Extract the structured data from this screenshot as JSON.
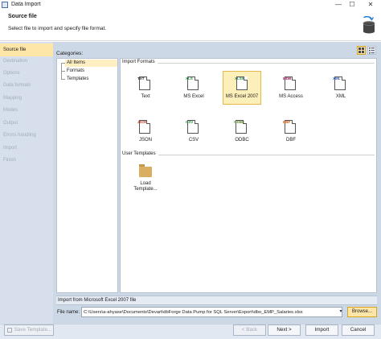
{
  "window": {
    "title": "Data Import",
    "minimize": "—",
    "maximize": "☐",
    "close": "✕"
  },
  "header": {
    "title": "Source file",
    "subtitle": "Select file to import and specify file format."
  },
  "sidebar": {
    "items": [
      {
        "label": "Source file",
        "active": true
      },
      {
        "label": "Destination",
        "active": false
      },
      {
        "label": "Options",
        "active": false
      },
      {
        "label": "Data formats",
        "active": false
      },
      {
        "label": "Mapping",
        "active": false
      },
      {
        "label": "Modes",
        "active": false
      },
      {
        "label": "Output",
        "active": false
      },
      {
        "label": "Errors handling",
        "active": false
      },
      {
        "label": "Import",
        "active": false
      },
      {
        "label": "Finish",
        "active": false
      }
    ]
  },
  "categories": {
    "label": "Categories:",
    "items": [
      "All Items",
      "Formats",
      "Templates"
    ]
  },
  "import_formats": {
    "title": "Import Formats",
    "tiles": [
      {
        "tag": "TXT",
        "caption": "Text",
        "color": "#222222",
        "icon": "text-file-icon"
      },
      {
        "tag": "XLS",
        "caption": "MS Excel",
        "color": "#1e8a3a",
        "icon": "excel-file-icon"
      },
      {
        "tag": "XLSX",
        "caption": "MS Excel 2007",
        "color": "#1e8a3a",
        "icon": "excel-2007-file-icon"
      },
      {
        "tag": "MDB",
        "caption": "MS Access",
        "color": "#a0205a",
        "icon": "access-file-icon"
      },
      {
        "tag": "XML",
        "caption": "XML",
        "color": "#2a55c0",
        "icon": "xml-file-icon"
      },
      {
        "tag": "JSON",
        "caption": "JSON",
        "color": "#c0392b",
        "icon": "json-file-icon"
      },
      {
        "tag": "CSV",
        "caption": "CSV",
        "color": "#1e8a3a",
        "icon": "csv-file-icon"
      },
      {
        "tag": "ODBC",
        "caption": "ODBC",
        "color": "#5a8a2a",
        "icon": "odbc-file-icon"
      },
      {
        "tag": "DBF",
        "caption": "DBF",
        "color": "#d35400",
        "icon": "dbf-file-icon"
      }
    ]
  },
  "user_templates": {
    "title": "User Templates",
    "load_caption_1": "Load",
    "load_caption_2": "Template..."
  },
  "status": {
    "text": "Import from Microsoft Excel 2007 file"
  },
  "file": {
    "label": "File name:",
    "value": "C:\\Users\\a-ahyase\\Documents\\Devart\\dbForge Data Pump for SQL Server\\Export\\dbo_EMP_Salaries.xlsx",
    "dropdown": "▾",
    "browse": "Browse..."
  },
  "footer": {
    "save_template": "Save Template...",
    "back": "< Back",
    "next": "Next >",
    "import": "Import",
    "cancel": "Cancel"
  }
}
